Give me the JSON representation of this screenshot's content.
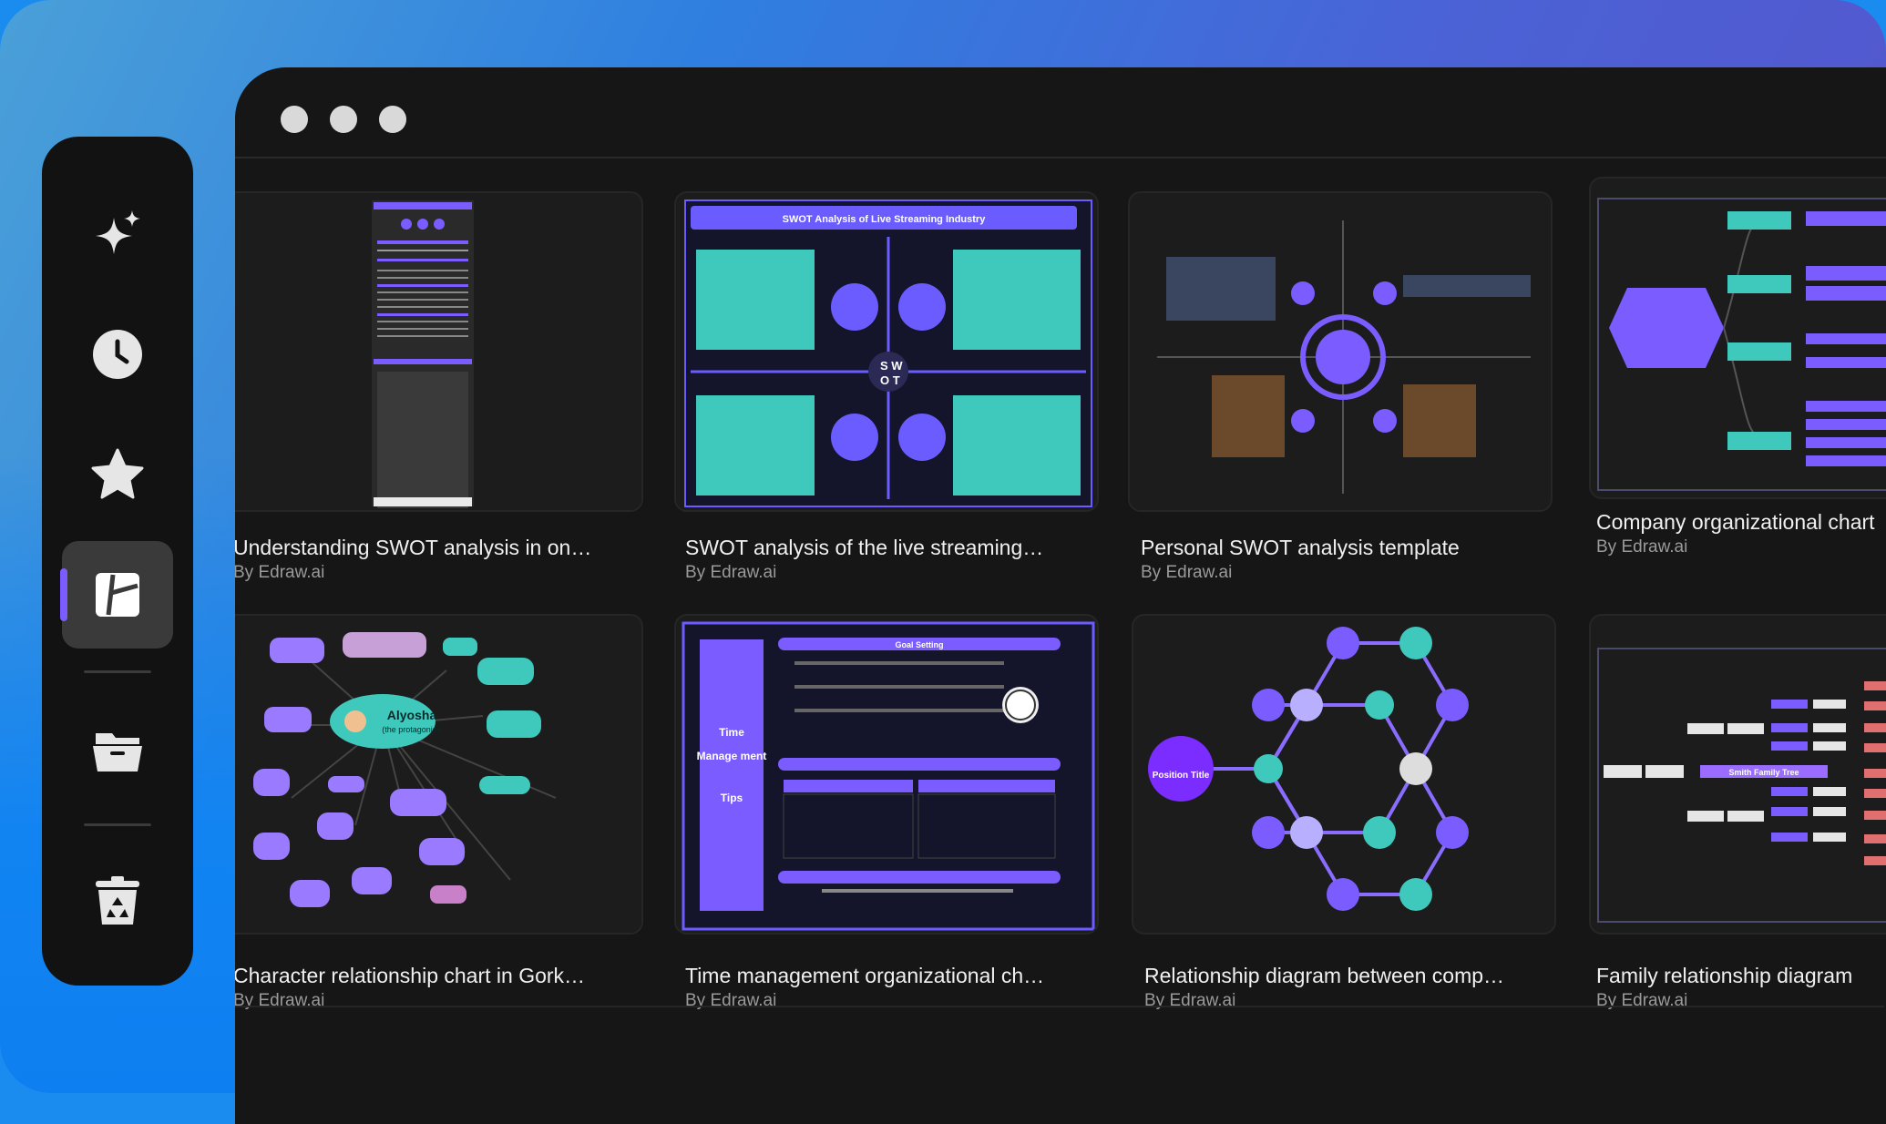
{
  "sidebar": {
    "items": [
      {
        "icon": "sparkle-icon",
        "active": false
      },
      {
        "icon": "clock-icon",
        "active": false
      },
      {
        "icon": "star-icon",
        "active": false
      },
      {
        "icon": "templates-icon",
        "active": true
      },
      {
        "icon": "folder-icon",
        "active": false
      },
      {
        "icon": "recycle-bin-icon",
        "active": false
      }
    ]
  },
  "colors": {
    "accent": "#7b5cff",
    "teal": "#4fd1c5",
    "window_bg": "#161616",
    "sidebar_bg": "#121212"
  },
  "templates": [
    {
      "title": "Understanding SWOT analysis in on…",
      "author": "By Edraw.ai"
    },
    {
      "title": "SWOT analysis of the live streaming…",
      "author": "By Edraw.ai",
      "thumb_heading": "SWOT Analysis of Live Streaming Industry"
    },
    {
      "title": "Personal SWOT analysis template",
      "author": "By Edraw.ai"
    },
    {
      "title": "Company organizational chart",
      "author": "By Edraw.ai"
    },
    {
      "title": "Character relationship chart in Gork…",
      "author": "By Edraw.ai",
      "thumb_center": "Alyosha",
      "thumb_center_sub": "(the protagonist)"
    },
    {
      "title": "Time management organizational ch…",
      "author": "By Edraw.ai",
      "thumb_side": [
        "Time",
        "Manage ment",
        "Tips"
      ],
      "thumb_heading": "Goal Setting"
    },
    {
      "title": "Relationship diagram between comp…",
      "author": "By Edraw.ai",
      "thumb_center": "Position Title"
    },
    {
      "title": "Family relationship diagram",
      "author": "By Edraw.ai",
      "thumb_heading": "Smith Family Tree"
    }
  ]
}
